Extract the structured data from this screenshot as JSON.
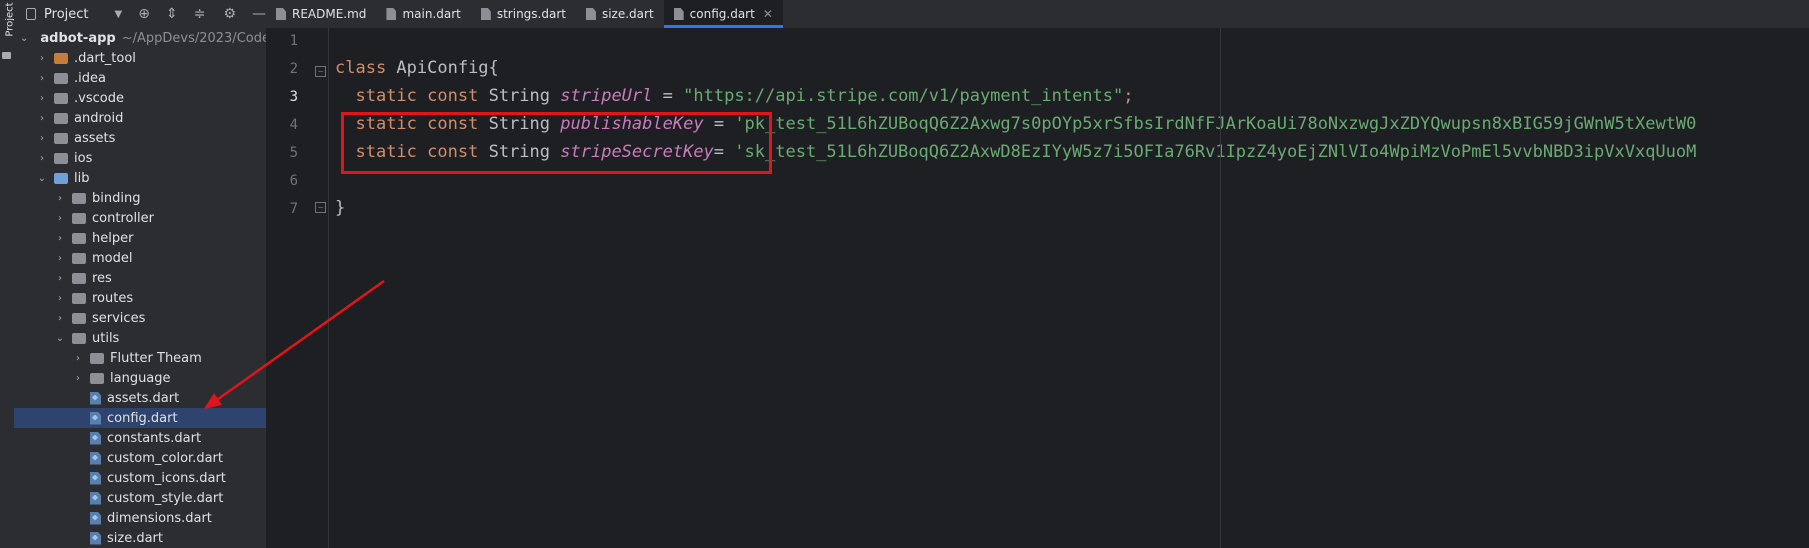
{
  "project_panel": {
    "title": "Project",
    "vertical_label": "Project",
    "root": {
      "name": "adbot-app",
      "path": "~/AppDevs/2023/Code"
    },
    "items": [
      {
        "label": ".dart_tool",
        "type": "folder",
        "expanded": false
      },
      {
        "label": ".idea",
        "type": "folder",
        "expanded": false
      },
      {
        "label": ".vscode",
        "type": "folder",
        "expanded": false
      },
      {
        "label": "android",
        "type": "folder",
        "expanded": false
      },
      {
        "label": "assets",
        "type": "folder",
        "expanded": false
      },
      {
        "label": "ios",
        "type": "folder",
        "expanded": false
      },
      {
        "label": "lib",
        "type": "folder",
        "expanded": true
      },
      {
        "label": "binding",
        "type": "folder",
        "expanded": false
      },
      {
        "label": "controller",
        "type": "folder",
        "expanded": false
      },
      {
        "label": "helper",
        "type": "folder",
        "expanded": false
      },
      {
        "label": "model",
        "type": "folder",
        "expanded": false
      },
      {
        "label": "res",
        "type": "folder",
        "expanded": false
      },
      {
        "label": "routes",
        "type": "folder",
        "expanded": false
      },
      {
        "label": "services",
        "type": "folder",
        "expanded": false
      },
      {
        "label": "utils",
        "type": "folder",
        "expanded": true
      },
      {
        "label": "Flutter Theam",
        "type": "folder",
        "expanded": false
      },
      {
        "label": "language",
        "type": "folder",
        "expanded": false
      },
      {
        "label": "assets.dart",
        "type": "dart-file"
      },
      {
        "label": "config.dart",
        "type": "dart-file",
        "selected": true
      },
      {
        "label": "constants.dart",
        "type": "dart-file"
      },
      {
        "label": "custom_color.dart",
        "type": "dart-file"
      },
      {
        "label": "custom_icons.dart",
        "type": "dart-file"
      },
      {
        "label": "custom_style.dart",
        "type": "dart-file"
      },
      {
        "label": "dimensions.dart",
        "type": "dart-file"
      },
      {
        "label": "size.dart",
        "type": "dart-file"
      }
    ]
  },
  "tabs": [
    {
      "label": "README.md",
      "active": false
    },
    {
      "label": "main.dart",
      "active": false
    },
    {
      "label": "strings.dart",
      "active": false
    },
    {
      "label": "size.dart",
      "active": false
    },
    {
      "label": "config.dart",
      "active": true
    }
  ],
  "editor": {
    "line_numbers": [
      "1",
      "2",
      "3",
      "4",
      "5",
      "6",
      "7"
    ],
    "current_line": "3",
    "code": {
      "l2_kw": "class",
      "l2_name": " ApiConfig{",
      "kw_static": "static",
      "kw_const": "const",
      "type_string": "String",
      "l3_field": "stripeUrl",
      "l3_value": "\"https://api.stripe.com/v1/payment_intents\"",
      "l4_field": "publishableKey",
      "l4_value": "'pk_test_51L6hZUBoqQ6Z2Axwg7s0pOYp5xrSfbsIrdNfFJArKoaUi78oNxzwgJxZDYQwupsn8xBIG59jGWnW5tXewtW0",
      "l5_field": "stripeSecretKey",
      "l5_value": "'sk_test_51L6hZUBoqQ6Z2AxwD8EzIYyW5z7i5OFIa76Rv1IpzZ4yoEjZNlVIo4WpiMzVoPmEl5vvbNBD3ipVxVxqUuoM",
      "l7_brace": "}"
    }
  },
  "colors": {
    "annotation_red": "#e0151b",
    "selection": "#2e436e",
    "accent": "#3574f0"
  }
}
